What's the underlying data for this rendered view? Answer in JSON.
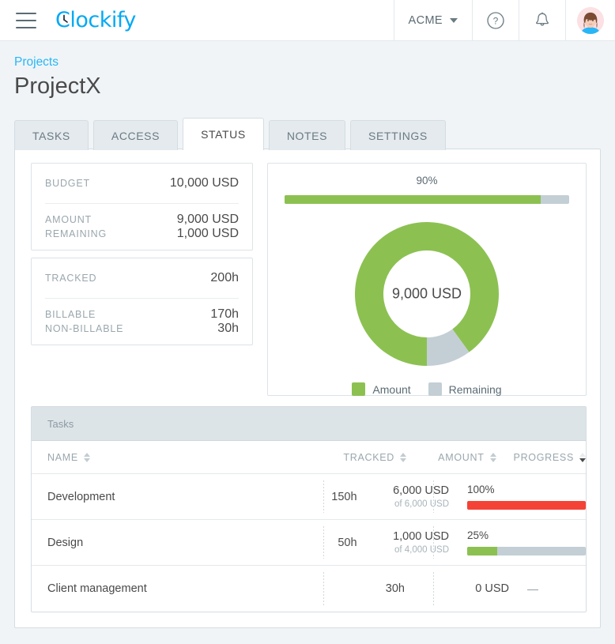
{
  "topbar": {
    "menu_icon": "hamburger-menu-icon",
    "logo_text": "Clockify",
    "workspace": "ACME",
    "workspace_caret": "chevron-down-icon",
    "help_icon": "help-circle-icon",
    "notifications_icon": "bell-icon",
    "avatar": "user-avatar"
  },
  "breadcrumb": {
    "parent": "Projects"
  },
  "page_title": "ProjectX",
  "tabs": [
    {
      "label": "TASKS",
      "active": false
    },
    {
      "label": "ACCESS",
      "active": false
    },
    {
      "label": "STATUS",
      "active": true
    },
    {
      "label": "NOTES",
      "active": false
    },
    {
      "label": "SETTINGS",
      "active": false
    }
  ],
  "budget_panel": {
    "budget_label": "BUDGET",
    "budget_value": "10,000 USD",
    "amount_label": "AMOUNT",
    "amount_value": "9,000 USD",
    "remaining_label": "REMAINING",
    "remaining_value": "1,000 USD"
  },
  "time_panel": {
    "tracked_label": "TRACKED",
    "tracked_value": "200h",
    "billable_label": "BILLABLE",
    "billable_value": "170h",
    "nonbillable_label": "NON-BILLABLE",
    "nonbillable_value": "30h"
  },
  "chart_data": {
    "type": "pie",
    "title": "",
    "labels": [
      "Amount",
      "Remaining"
    ],
    "values": [
      9000,
      1000
    ],
    "percentages": [
      90,
      10
    ],
    "colors": [
      "#8cc152",
      "#c3cfd5"
    ],
    "center_label": "9,000 USD",
    "units": "USD",
    "total": 10000,
    "legend_position": "bottom",
    "progress_bar": {
      "type": "bar",
      "label": "90%",
      "percent": 90,
      "fill_color": "#8cc152",
      "track_color": "#c3cfd5"
    }
  },
  "tasks_table": {
    "section_title": "Tasks",
    "columns": [
      {
        "label": "NAME",
        "sorted": false
      },
      {
        "label": "TRACKED",
        "sorted": false
      },
      {
        "label": "AMOUNT",
        "sorted": false
      },
      {
        "label": "PROGRESS",
        "sorted": true,
        "direction": "desc"
      }
    ],
    "rows": [
      {
        "name": "Development",
        "tracked": "150h",
        "amount": "6,000 USD",
        "amount_of": "of 6,000 USD",
        "progress_label": "100%",
        "progress_percent": 100,
        "progress_color": "#f44336",
        "has_bar": true
      },
      {
        "name": "Design",
        "tracked": "50h",
        "amount": "1,000 USD",
        "amount_of": "of 4,000 USD",
        "progress_label": "25%",
        "progress_percent": 25,
        "progress_color": "#8cc152",
        "has_bar": true
      },
      {
        "name": "Client management",
        "tracked": "30h",
        "amount": "0 USD",
        "amount_of": "",
        "progress_label": "—",
        "progress_percent": 0,
        "progress_color": "",
        "has_bar": false
      }
    ]
  },
  "colors": {
    "brand": "#03a9f4",
    "green": "#8cc152",
    "grey": "#c3cfd5",
    "red": "#f44336",
    "page_bg": "#f0f4f7"
  }
}
